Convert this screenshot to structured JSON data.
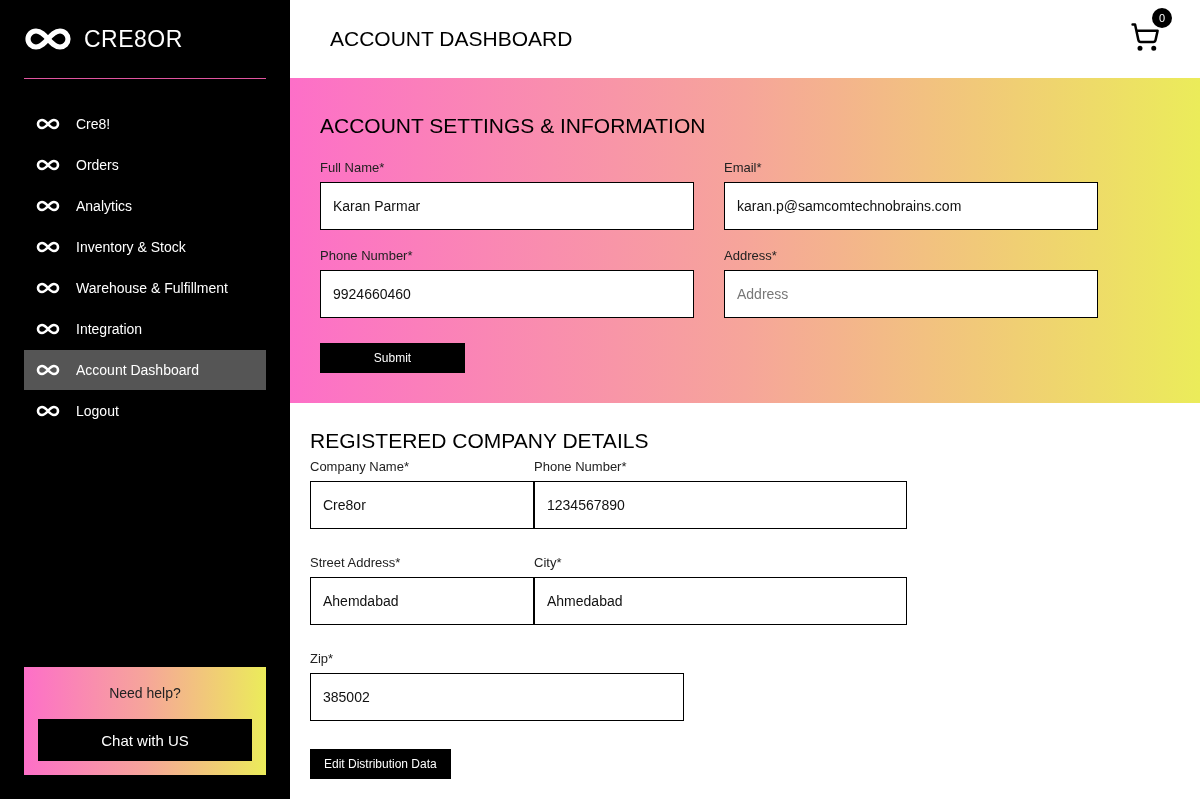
{
  "brand": {
    "name": "CRE8OR"
  },
  "nav": [
    {
      "label": "Cre8!",
      "selected": false
    },
    {
      "label": "Orders",
      "selected": false
    },
    {
      "label": "Analytics",
      "selected": false
    },
    {
      "label": "Inventory & Stock",
      "selected": false
    },
    {
      "label": "Warehouse & Fulfillment",
      "selected": false
    },
    {
      "label": "Integration",
      "selected": false
    },
    {
      "label": "Account Dashboard",
      "selected": true
    },
    {
      "label": "Logout",
      "selected": false
    }
  ],
  "help": {
    "title": "Need help?",
    "button": "Chat with US"
  },
  "header": {
    "title": "ACCOUNT DASHBOARD",
    "cart_count": "0"
  },
  "account": {
    "title": "ACCOUNT SETTINGS & INFORMATION",
    "fields": [
      {
        "label": "Full Name*",
        "value": "Karan Parmar"
      },
      {
        "label": "Email*",
        "value": "karan.p@samcomtechnobrains.com"
      },
      {
        "label": "Phone Number*",
        "value": "9924660460"
      },
      {
        "label": "Address*",
        "placeholder": "Address"
      }
    ],
    "submit": "Submit"
  },
  "company": {
    "title": "REGISTERED COMPANY DETAILS",
    "rows": [
      {
        "fields": [
          {
            "label": "Company Name*",
            "value": "Cre8or"
          },
          {
            "label": "Phone Number*",
            "value": "1234567890"
          }
        ]
      },
      {
        "fields": [
          {
            "label": "Street Address*",
            "value": "Ahemdabad"
          },
          {
            "label": "City*",
            "value": "Ahmedabad"
          }
        ]
      },
      {
        "fields": [
          {
            "label": "Zip*",
            "value": "385002"
          }
        ]
      }
    ],
    "button": "Edit Distribution Data"
  }
}
